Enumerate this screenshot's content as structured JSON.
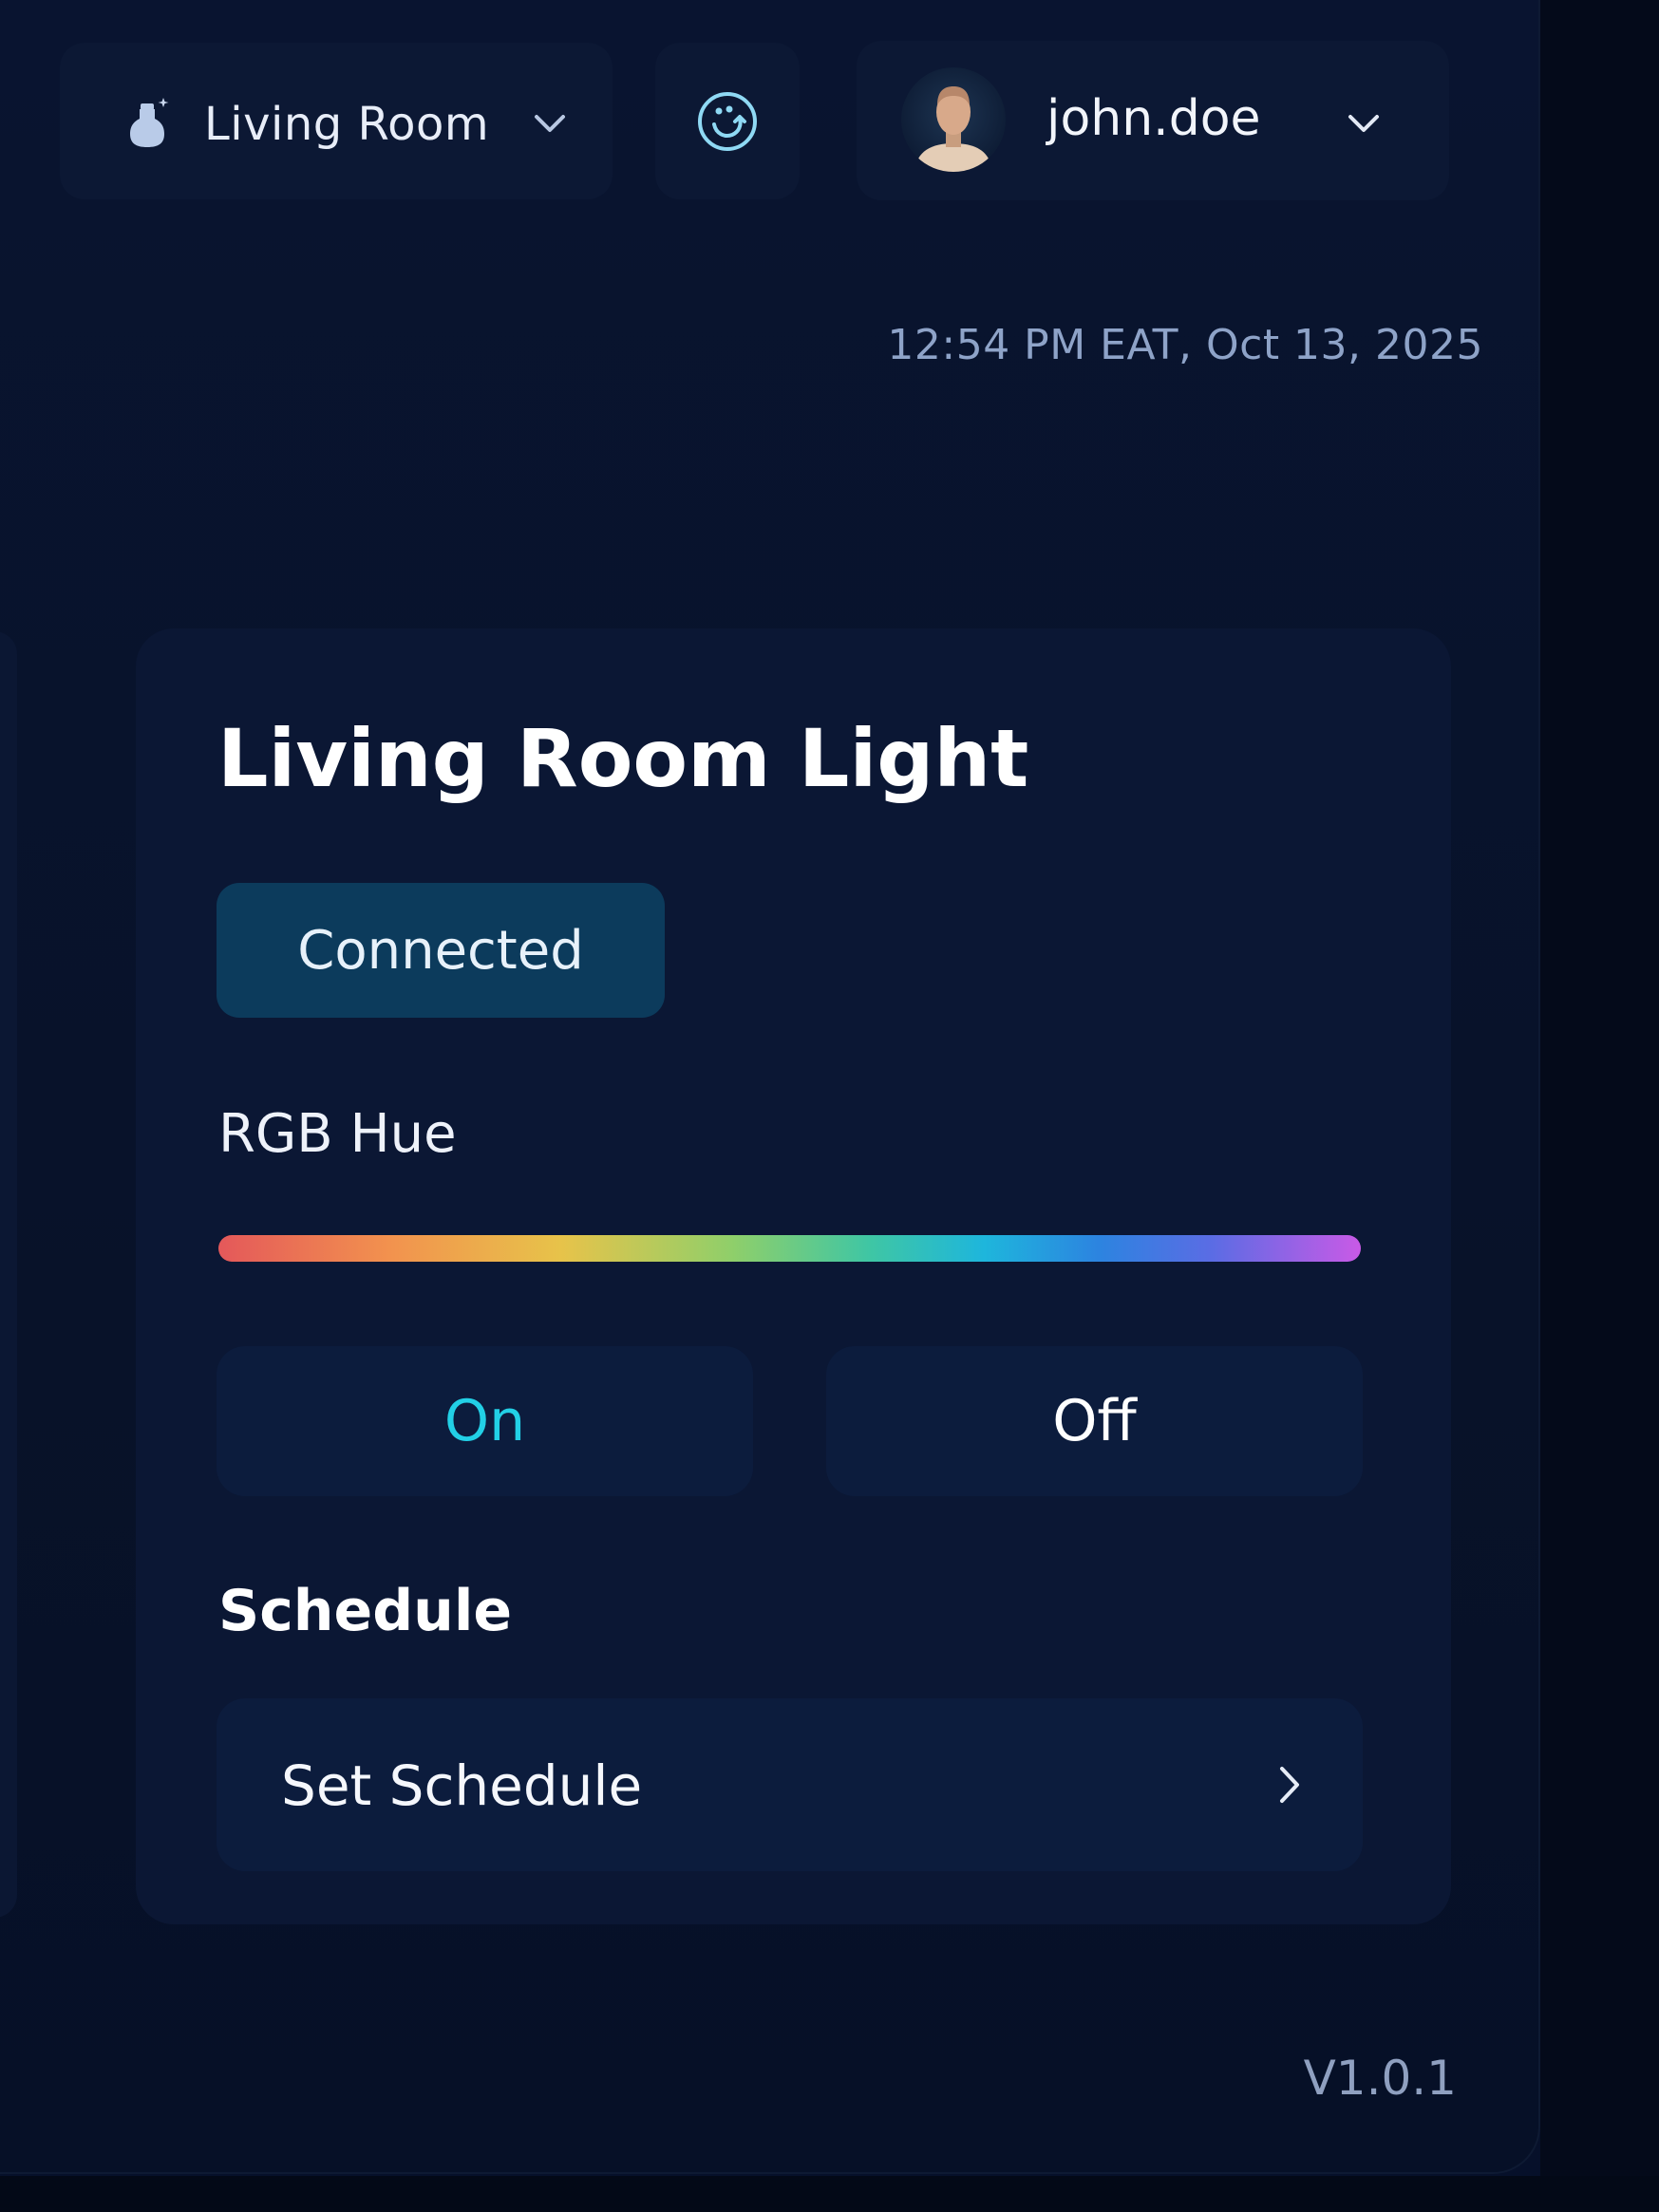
{
  "header": {
    "room_selector": {
      "label": "Living Room",
      "icon": "room-bulb-icon"
    },
    "status_icon": "device-sync-icon",
    "user": {
      "name": "john.doe",
      "avatar": "user-avatar"
    }
  },
  "timestamp": "12:54 PM EAT, Oct 13, 2025",
  "device_card": {
    "title": "Living Room Light",
    "status_badge": "Connected",
    "hue_label": "RGB Hue",
    "on_label": "On",
    "off_label": "Off",
    "schedule_heading": "Schedule",
    "schedule_button": "Set Schedule"
  },
  "footer": {
    "version": "V1.0.1"
  },
  "colors": {
    "background": "#081229",
    "card": "#0b1734",
    "badge": "#0c3b5c",
    "accent_on": "#22d0e6",
    "muted_text": "#8ea3c8"
  }
}
